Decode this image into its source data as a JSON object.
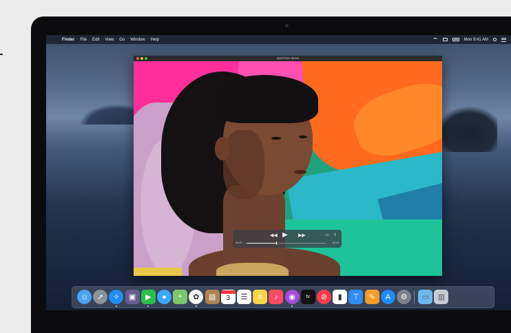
{
  "menubar": {
    "app": "Finder",
    "items": [
      "File",
      "Edit",
      "View",
      "Go",
      "Window",
      "Help"
    ],
    "clock": "Mon 9:41 AM"
  },
  "quicktime": {
    "title": "QuickTime Movie",
    "elapsed": "00:00",
    "remaining": "-00:45",
    "progress": 0.37
  },
  "dock": {
    "apps": [
      {
        "name": "Finder",
        "icon": "finder-icon",
        "color": "#4aa3f0"
      },
      {
        "name": "Launchpad",
        "icon": "rocket-icon",
        "color": "#8c929c"
      },
      {
        "name": "Safari",
        "icon": "compass-icon",
        "color": "#1f8ff5"
      },
      {
        "name": "Photo Booth",
        "icon": "photo-booth-icon",
        "color": "#6a5b8e"
      },
      {
        "name": "FaceTime",
        "icon": "video-camera-icon",
        "color": "#2bbf4a"
      },
      {
        "name": "Messages",
        "icon": "speech-bubble-icon",
        "color": "#3ba7ff"
      },
      {
        "name": "Maps",
        "icon": "map-icon",
        "color": "#7cc66c"
      },
      {
        "name": "Photos",
        "icon": "photos-flower-icon",
        "color": "#f5f5f5"
      },
      {
        "name": "Contacts",
        "icon": "contacts-book-icon",
        "color": "#b08452"
      },
      {
        "name": "Calendar",
        "icon": "calendar-icon",
        "color": "#ffffff"
      },
      {
        "name": "Reminders",
        "icon": "checklist-icon",
        "color": "#ffffff"
      },
      {
        "name": "Notes",
        "icon": "notes-icon",
        "color": "#f7d54a"
      },
      {
        "name": "Music",
        "icon": "music-note-icon",
        "color": "#fb4b60"
      },
      {
        "name": "Podcasts",
        "icon": "podcast-icon",
        "color": "#a54bdc"
      },
      {
        "name": "TV",
        "icon": "tv-icon",
        "color": "#111111"
      },
      {
        "name": "News",
        "icon": "news-icon",
        "color": "#ff3b4c"
      },
      {
        "name": "Numbers",
        "icon": "bar-chart-icon",
        "color": "#ffffff"
      },
      {
        "name": "Keynote",
        "icon": "podium-icon",
        "color": "#2f8cf2"
      },
      {
        "name": "Pages",
        "icon": "pen-paper-icon",
        "color": "#f49b28"
      },
      {
        "name": "App Store",
        "icon": "app-store-icon",
        "color": "#1d8cf5"
      },
      {
        "name": "System Preferences",
        "icon": "gear-icon",
        "color": "#7d828a"
      }
    ],
    "folder": {
      "name": "Downloads",
      "icon": "folder-icon",
      "color": "#6ab8ee"
    },
    "trash": {
      "name": "Trash",
      "icon": "trash-icon",
      "color": "#c9ccd2"
    },
    "calendar_day": "3",
    "tv_label": "tv"
  }
}
